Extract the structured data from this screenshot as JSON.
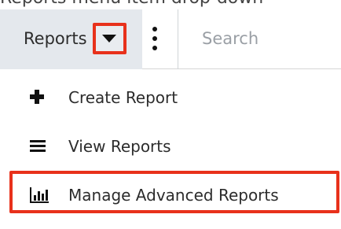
{
  "header": {
    "cut_text": "Reports menu item drop-down",
    "module_tab_label": "Reports",
    "search_placeholder": "Search"
  },
  "menu": {
    "items": [
      {
        "label": "Create Report",
        "icon": "plus-icon"
      },
      {
        "label": "View Reports",
        "icon": "list-icon"
      },
      {
        "label": "Manage Advanced Reports",
        "icon": "bar-chart-icon"
      }
    ]
  },
  "colors": {
    "highlight": "#e8311b",
    "tab_background": "#e4e8ed",
    "text": "#2c2c2c",
    "placeholder": "#9a9fa5"
  }
}
